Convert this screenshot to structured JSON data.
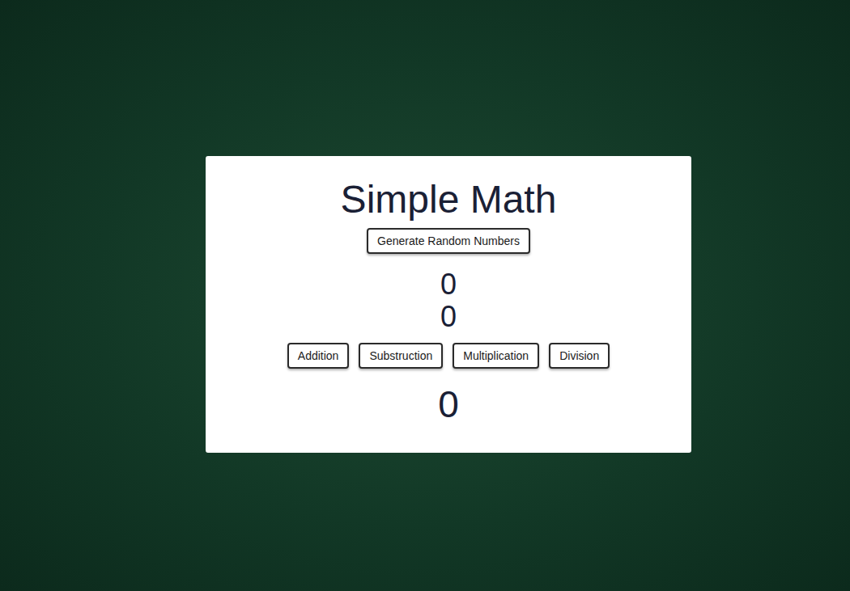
{
  "card": {
    "title": "Simple Math",
    "generate_button": "Generate Random Numbers",
    "numbers": [
      "0",
      "0"
    ],
    "operations": [
      {
        "label": "Addition"
      },
      {
        "label": "Substruction"
      },
      {
        "label": "Multiplication"
      },
      {
        "label": "Division"
      }
    ],
    "result": "0"
  }
}
